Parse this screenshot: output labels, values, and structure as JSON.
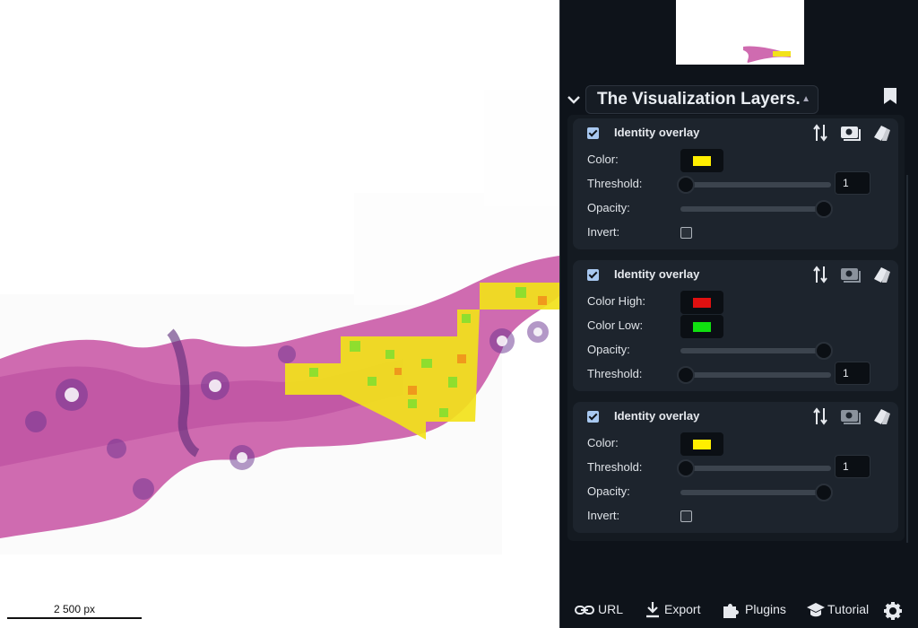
{
  "viewer": {
    "scalebar_label": "2 500 px"
  },
  "panel": {
    "title": "The Visualization Layers.",
    "layers": [
      {
        "name": "Identity overlay",
        "rows": [
          {
            "label": "Color:",
            "type": "color",
            "color": "#ffee00"
          },
          {
            "label": "Threshold:",
            "type": "slider",
            "value_fraction": 0.0,
            "number": "1"
          },
          {
            "label": "Opacity:",
            "type": "slider",
            "value_fraction": 1.0
          },
          {
            "label": "Invert:",
            "type": "checkbox",
            "checked": false
          }
        ]
      },
      {
        "name": "Identity overlay",
        "rows": [
          {
            "label": "Color High:",
            "type": "color",
            "color": "#e01010"
          },
          {
            "label": "Color Low:",
            "type": "color",
            "color": "#10e010"
          },
          {
            "label": "Opacity:",
            "type": "slider",
            "value_fraction": 1.0
          },
          {
            "label": "Threshold:",
            "type": "slider",
            "value_fraction": 0.0,
            "number": "1"
          }
        ]
      },
      {
        "name": "Identity overlay",
        "rows": [
          {
            "label": "Color:",
            "type": "color",
            "color": "#ffee00"
          },
          {
            "label": "Threshold:",
            "type": "slider",
            "value_fraction": 0.0,
            "number": "1"
          },
          {
            "label": "Opacity:",
            "type": "slider",
            "value_fraction": 1.0
          },
          {
            "label": "Invert:",
            "type": "checkbox",
            "checked": false
          }
        ]
      }
    ],
    "footer": {
      "url": "URL",
      "export": "Export",
      "plugins": "Plugins",
      "tutorial": "Tutorial"
    }
  },
  "colors": {
    "panel_bg": "#0e131a",
    "tissue": "#c85aa8",
    "overlay_yellow": "#ffee00"
  }
}
